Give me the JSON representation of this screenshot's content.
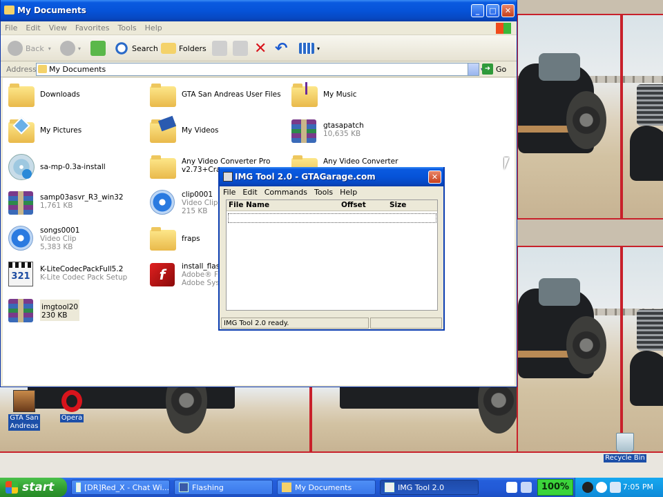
{
  "explorer": {
    "title": "My Documents",
    "menu": [
      "File",
      "Edit",
      "View",
      "Favorites",
      "Tools",
      "Help"
    ],
    "toolbar": {
      "back": "Back",
      "search": "Search",
      "folders": "Folders"
    },
    "address_label": "Address",
    "address_value": "My Documents",
    "go_label": "Go",
    "items": [
      {
        "name": "Downloads",
        "sub1": "",
        "sub2": "",
        "icon": "folder-icon"
      },
      {
        "name": "GTA San Andreas User Files",
        "sub1": "",
        "sub2": "",
        "icon": "folder-icon"
      },
      {
        "name": "My Music",
        "sub1": "",
        "sub2": "",
        "icon": "music-folder-icon"
      },
      {
        "name": "My Pictures",
        "sub1": "",
        "sub2": "",
        "icon": "pictures-folder-icon"
      },
      {
        "name": "My Videos",
        "sub1": "",
        "sub2": "",
        "icon": "videos-folder-icon"
      },
      {
        "name": "gtasapatch",
        "sub1": "10,635 KB",
        "sub2": "",
        "icon": "winrar-archive-icon"
      },
      {
        "name": "sa-mp-0.3a-install",
        "sub1": "",
        "sub2": "",
        "icon": "installer-disc-icon"
      },
      {
        "name": "Any Video Converter Pro",
        "sub1": "v2.73+Crac",
        "sub2": "",
        "icon": "folder-icon"
      },
      {
        "name": "Any Video Converter",
        "sub1": "",
        "sub2": "",
        "icon": "folder-icon"
      },
      {
        "name": "samp03asvr_R3_win32",
        "sub1": "1,761 KB",
        "sub2": "",
        "icon": "winrar-archive-icon"
      },
      {
        "name": "clip0001",
        "sub1": "Video Clip",
        "sub2": "215 KB",
        "icon": "media-player-icon"
      },
      {
        "name": "songs0001",
        "sub1": "Video Clip",
        "sub2": "5,383 KB",
        "icon": "media-player-icon"
      },
      {
        "name": "fraps",
        "sub1": "",
        "sub2": "",
        "icon": "folder-icon"
      },
      {
        "name": "K-LiteCodecPackFull5.2",
        "sub1": "K-Lite Codec Pack Setup",
        "sub2": "",
        "icon": "klite-clapper-icon"
      },
      {
        "name": "install_flash",
        "sub1": "Adobe® Fla",
        "sub2": "Adobe Syst",
        "icon": "flash-icon"
      },
      {
        "name": "imgtool20",
        "sub1": "230 KB",
        "sub2": "",
        "icon": "winrar-archive-icon"
      }
    ]
  },
  "imgtool": {
    "title": "IMG Tool 2.0 - GTAGarage.com",
    "menu": [
      "File",
      "Edit",
      "Commands",
      "Tools",
      "Help"
    ],
    "columns": [
      "File Name",
      "Offset",
      "Size"
    ],
    "status": "IMG Tool 2.0 ready."
  },
  "desktop": {
    "icons": [
      {
        "label1": "GTA San",
        "label2": "Andreas"
      },
      {
        "label1": "Opera",
        "label2": ""
      },
      {
        "label1": "Recycle Bin",
        "label2": ""
      }
    ]
  },
  "taskbar": {
    "start_label": "start",
    "tasks": [
      "[DR]Red_X - Chat Wi...",
      "Flashing",
      "My Documents",
      "IMG Tool 2.0"
    ],
    "percent": "100%",
    "clock": "7:05 PM"
  }
}
